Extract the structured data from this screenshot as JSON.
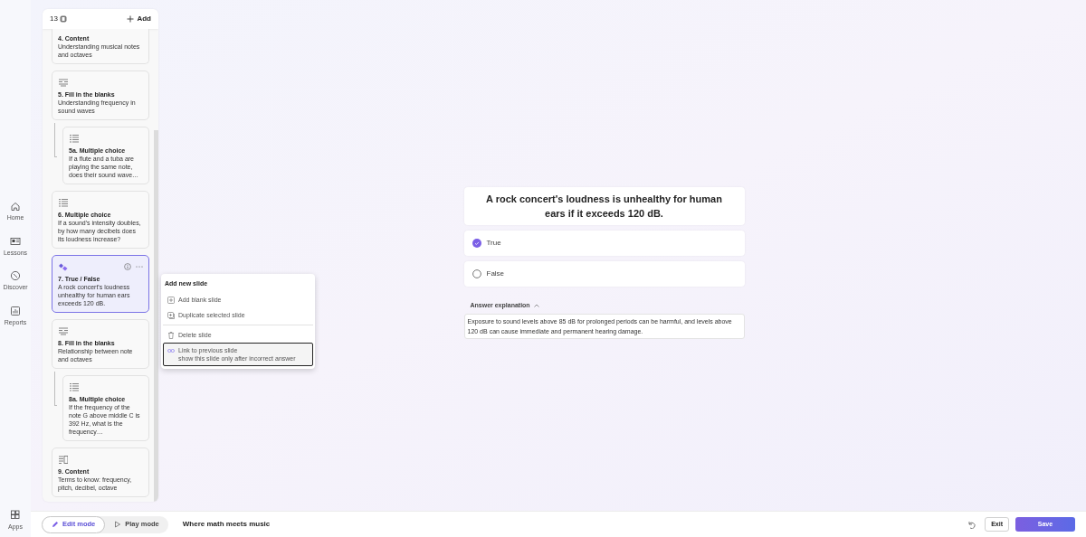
{
  "rail": [
    {
      "label": "Home",
      "kind": "home"
    },
    {
      "label": "Lessons",
      "kind": "lessons"
    },
    {
      "label": "Discover",
      "kind": "discover"
    },
    {
      "label": "Reports",
      "kind": "reports"
    }
  ],
  "rail_bottom": {
    "label": "Apps",
    "kind": "apps"
  },
  "panel": {
    "count": "13",
    "add": "Add"
  },
  "slides": [
    {
      "title": "4. Content",
      "description": "Understanding musical notes and octaves",
      "selected": false
    },
    {
      "kind": "fill",
      "title": "5. Fill in the blanks",
      "description": "Understanding frequency in sound waves",
      "selected": false,
      "children": [
        {
          "kind": "multiple_choice",
          "title": "5a. Multiple choice",
          "description": "If a flute and a tuba are playing the same note, does their sound wave…",
          "selected": false
        }
      ]
    },
    {
      "kind": "multiple_choice",
      "title": "6. Multiple choice",
      "description": "If a sound's intensity doubles, by how many decibels does its loudness increase?",
      "selected": false
    },
    {
      "kind": "true_false",
      "title": "7. True / False",
      "description": "A rock concert's loudness unhealthy for human ears exceeds 120 dB.",
      "selected": true
    },
    {
      "kind": "fill",
      "title": "8. Fill in the blanks",
      "description": "Relationship between note and octaves",
      "selected": false,
      "children": [
        {
          "kind": "multiple_choice",
          "title": "8a. Multiple choice",
          "description": "If the frequency of the note G above middle C is 392 Hz, what is the frequency…",
          "selected": false
        }
      ]
    },
    {
      "kind": "content",
      "title": "9. Content",
      "description": "Terms to know: frequency, pitch, decibel, octave",
      "selected": false
    }
  ],
  "menu": {
    "heading": "Add new slide",
    "items": [
      {
        "kind": "item",
        "label": "Add blank slide",
        "selected": false
      },
      {
        "kind": "item",
        "label": "Duplicate selected slide",
        "selected": false
      },
      {
        "kind": "divider"
      },
      {
        "kind": "item",
        "label": "Delete slide",
        "selected": false
      },
      {
        "kind": "item",
        "label": "Link to previous slide",
        "hint": "show this slide only after incorrect answer",
        "selected": true
      }
    ]
  },
  "question": {
    "text": "A rock concert's loudness is unhealthy for human ears if it exceeds 120 dB.",
    "options": [
      {
        "label": "True",
        "selected": true
      },
      {
        "label": "False",
        "selected": false
      }
    ],
    "explanation_label": "Answer explanation",
    "explanation_expanded": true,
    "explanation": "Exposure to sound levels above 85 dB for prolonged periods can be harmful, and levels above 120 dB can cause immediate and permanent hearing damage."
  },
  "bottom": {
    "modes": [
      {
        "label": "Edit mode",
        "selected": true
      },
      {
        "label": "Play mode",
        "selected": false
      }
    ],
    "title": "Where math meets music",
    "exit": "Exit",
    "save": "Save"
  }
}
